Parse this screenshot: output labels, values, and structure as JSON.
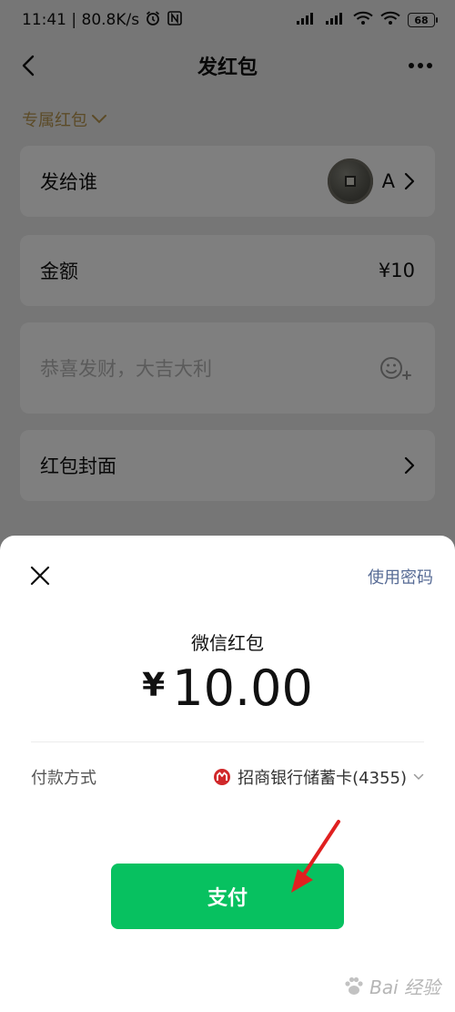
{
  "status_bar": {
    "left_text": "11:41 | 80.8K/s",
    "battery": "68"
  },
  "nav": {
    "title": "发红包"
  },
  "exclusive_label": "专属红包",
  "recipient": {
    "label": "发给谁",
    "name": "A"
  },
  "amount_row": {
    "label": "金额",
    "value": "¥10"
  },
  "message": {
    "placeholder": "恭喜发财，大吉大利"
  },
  "cover": {
    "label": "红包封面"
  },
  "pay_sheet": {
    "use_password": "使用密码",
    "title": "微信红包",
    "currency": "¥",
    "amount": "10.00",
    "method_label": "付款方式",
    "method_value": "招商银行储蓄卡(4355)",
    "pay_button": "支付"
  },
  "watermark": {
    "text": "Bai 经验"
  },
  "colors": {
    "wechat_green": "#07c160",
    "link_blue": "#576b95",
    "gold": "#b8964f",
    "bank_red": "#d0282a",
    "arrow_red": "#e02020"
  },
  "icons": [
    "back-icon",
    "more-icon",
    "chevron-down-icon",
    "chevron-right-icon",
    "emoji-add-icon",
    "close-icon",
    "bank-logo-icon",
    "arrow-annotation"
  ]
}
